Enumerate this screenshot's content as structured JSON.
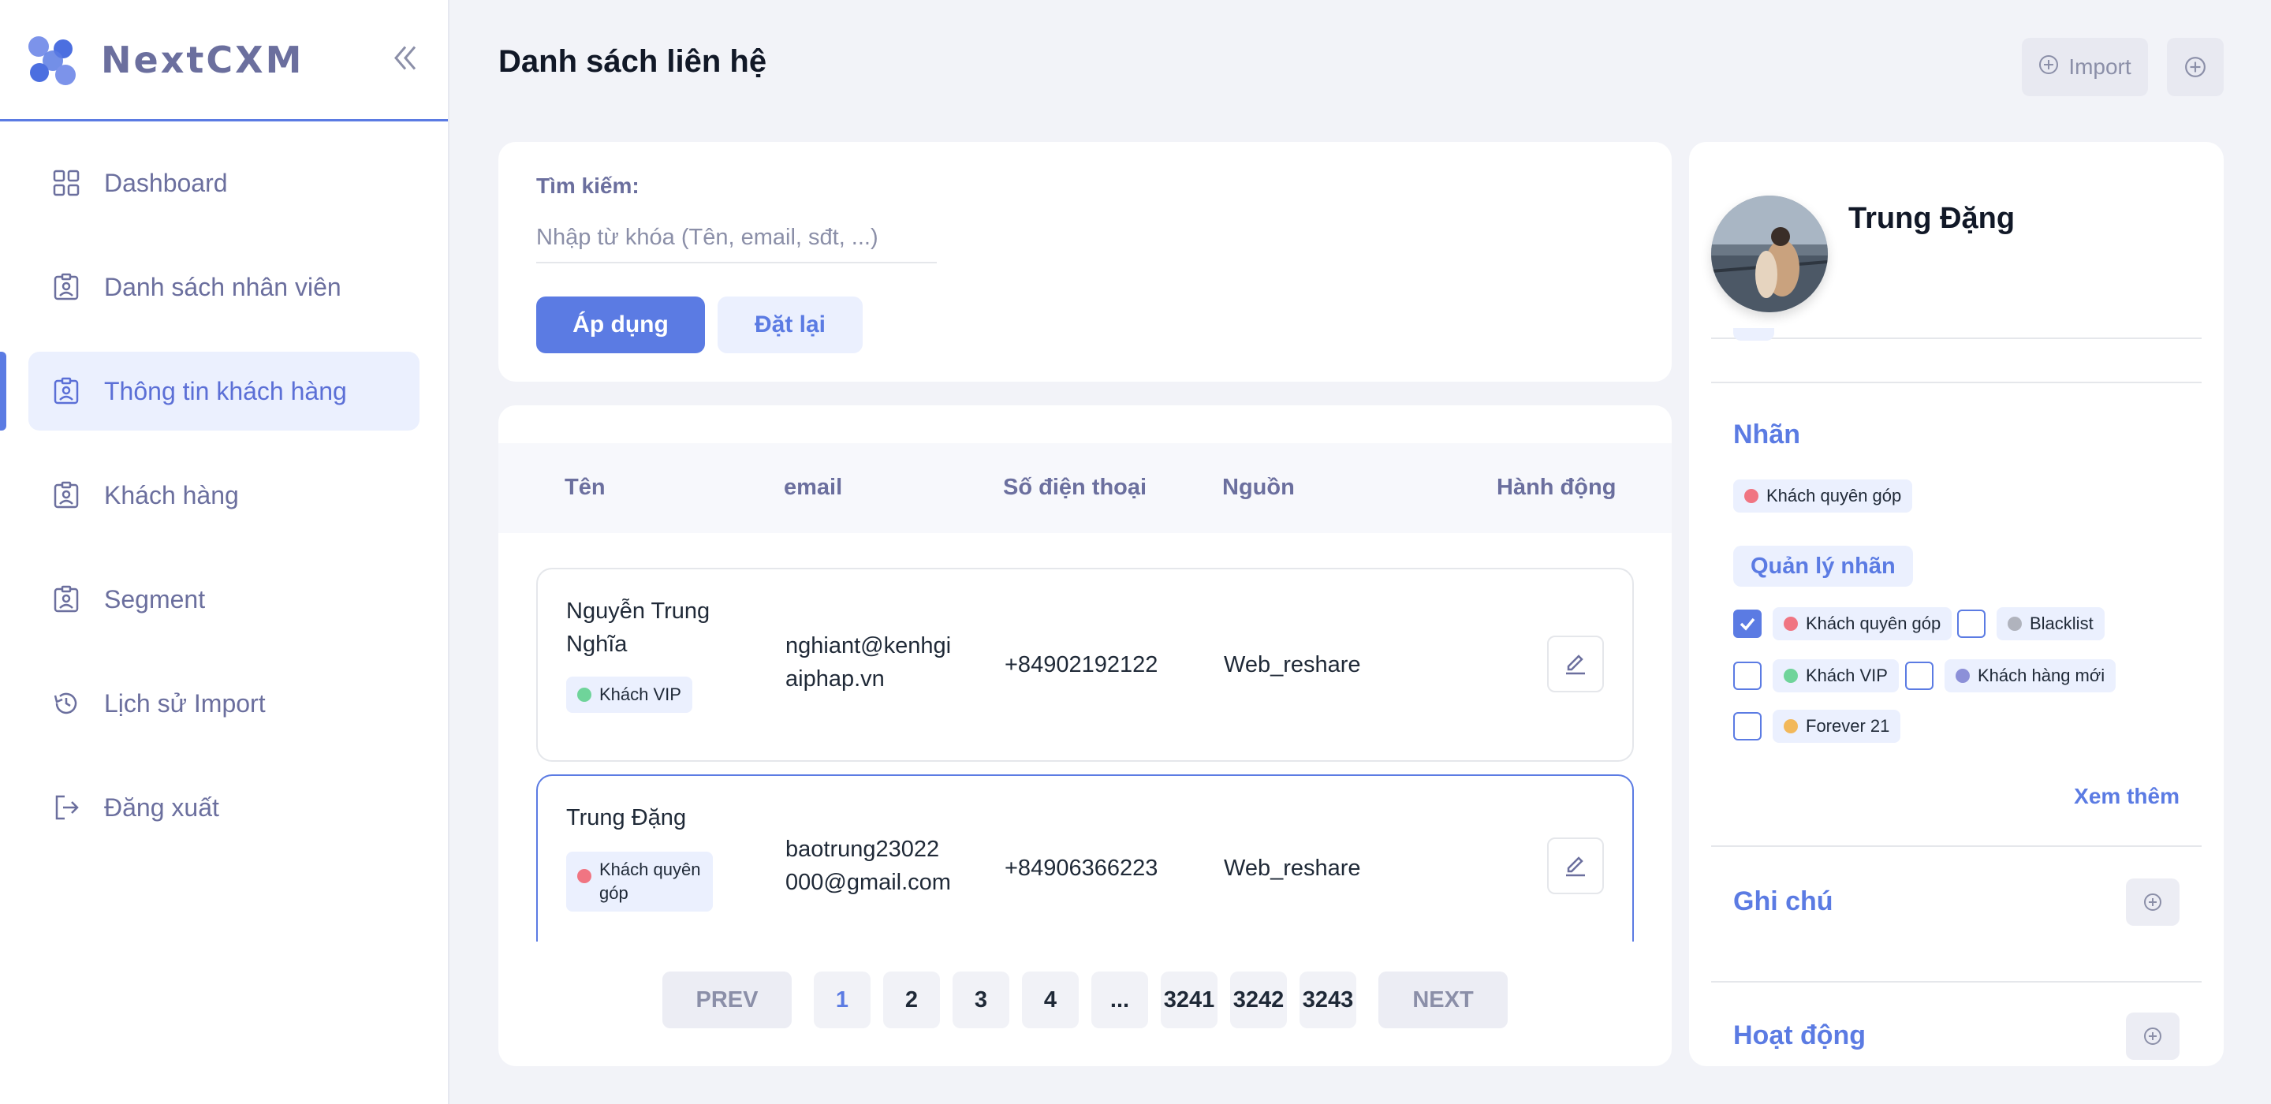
{
  "brand": {
    "name": "NextCXM"
  },
  "sidebar": {
    "items": [
      {
        "label": "Dashboard",
        "icon": "grid-icon"
      },
      {
        "label": "Danh sách nhân viên",
        "icon": "badge-icon"
      },
      {
        "label": "Thông tin khách hàng",
        "icon": "badge-icon",
        "active": true
      },
      {
        "label": "Khách hàng",
        "icon": "badge-icon"
      },
      {
        "label": "Segment",
        "icon": "badge-icon"
      },
      {
        "label": "Lịch sử Import",
        "icon": "history-icon"
      },
      {
        "label": "Đăng xuất",
        "icon": "logout-icon"
      }
    ]
  },
  "header": {
    "title": "Danh sách liên hệ",
    "import_label": "Import"
  },
  "search": {
    "label": "Tìm kiếm:",
    "placeholder": "Nhập từ khóa (Tên, email, sđt, ...)",
    "value": "",
    "apply_label": "Áp dụng",
    "reset_label": "Đặt lại"
  },
  "table": {
    "columns": [
      "Tên",
      "email",
      "Số điện thoại",
      "Nguồn",
      "Hành động"
    ],
    "rows": [
      {
        "name_line1": "Nguyễn Trung",
        "name_line2": "Nghĩa",
        "tag": "Khách VIP",
        "tag_color": "#6fd49a",
        "email_line1": "nghiant@kenhgi",
        "email_line2": "aiphap.vn",
        "phone": "+84902192122",
        "source": "Web_reshare"
      },
      {
        "name_line1": "Trung Đặng",
        "name_line2": "",
        "tag_line1": "Khách quyên",
        "tag_line2": "góp",
        "tag_color": "#f07582",
        "email_line1": "baotrung23022",
        "email_line2": "000@gmail.com",
        "phone": "+84906366223",
        "source": "Web_reshare",
        "selected": true
      }
    ]
  },
  "pagination": {
    "prev": "PREV",
    "next": "NEXT",
    "pages": [
      "1",
      "2",
      "3",
      "4",
      "...",
      "3241",
      "3242",
      "3243"
    ],
    "current": "1"
  },
  "detail": {
    "name": "Trung Đặng",
    "labels_title": "Nhãn",
    "assigned_label": "Khách quyên góp",
    "manage_label": "Quản lý nhãn",
    "label_options": [
      {
        "label": "Khách quyên góp",
        "color": "#f07582",
        "checked": true
      },
      {
        "label": "Blacklist",
        "color": "#b0b3bd",
        "checked": false
      },
      {
        "label": "Khách VIP",
        "color": "#6fd49a",
        "checked": false
      },
      {
        "label": "Khách hàng mới",
        "color": "#8c90d8",
        "checked": false
      },
      {
        "label": "Forever 21",
        "color": "#f2b85a",
        "checked": false
      }
    ],
    "see_more": "Xem thêm",
    "notes_title": "Ghi chú",
    "activity_title": "Hoạt động"
  },
  "colors": {
    "accent": "#5b7be3",
    "accent_soft": "#ebf0fe",
    "text_muted": "#6b6f9e"
  }
}
